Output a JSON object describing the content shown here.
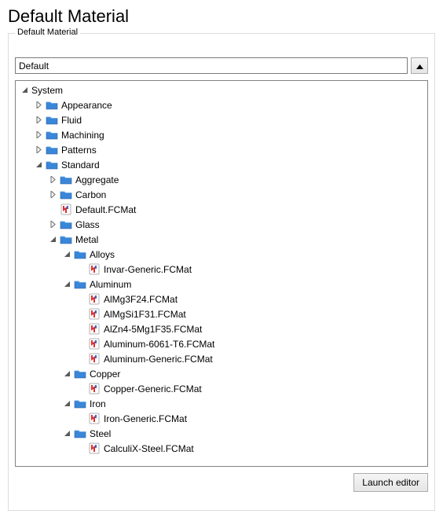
{
  "title": "Default Material",
  "group_label": "Default Material",
  "combo_value": "Default",
  "launch_editor_label": "Launch editor",
  "tree": [
    {
      "depth": 0,
      "kind": "root",
      "expand": "open",
      "label": "System"
    },
    {
      "depth": 1,
      "kind": "folder",
      "expand": "closed",
      "label": "Appearance"
    },
    {
      "depth": 1,
      "kind": "folder",
      "expand": "closed",
      "label": "Fluid"
    },
    {
      "depth": 1,
      "kind": "folder",
      "expand": "closed",
      "label": "Machining"
    },
    {
      "depth": 1,
      "kind": "folder",
      "expand": "closed",
      "label": "Patterns"
    },
    {
      "depth": 1,
      "kind": "folder",
      "expand": "open",
      "label": "Standard"
    },
    {
      "depth": 2,
      "kind": "folder",
      "expand": "closed",
      "label": "Aggregate"
    },
    {
      "depth": 2,
      "kind": "folder",
      "expand": "closed",
      "label": "Carbon"
    },
    {
      "depth": 2,
      "kind": "file",
      "expand": "none",
      "label": "Default.FCMat"
    },
    {
      "depth": 2,
      "kind": "folder",
      "expand": "closed",
      "label": "Glass"
    },
    {
      "depth": 2,
      "kind": "folder",
      "expand": "open",
      "label": "Metal"
    },
    {
      "depth": 3,
      "kind": "folder",
      "expand": "open",
      "label": "Alloys"
    },
    {
      "depth": 4,
      "kind": "file",
      "expand": "none",
      "label": "Invar-Generic.FCMat"
    },
    {
      "depth": 3,
      "kind": "folder",
      "expand": "open",
      "label": "Aluminum"
    },
    {
      "depth": 4,
      "kind": "file",
      "expand": "none",
      "label": "AlMg3F24.FCMat"
    },
    {
      "depth": 4,
      "kind": "file",
      "expand": "none",
      "label": "AlMgSi1F31.FCMat"
    },
    {
      "depth": 4,
      "kind": "file",
      "expand": "none",
      "label": "AlZn4-5Mg1F35.FCMat"
    },
    {
      "depth": 4,
      "kind": "file",
      "expand": "none",
      "label": "Aluminum-6061-T6.FCMat"
    },
    {
      "depth": 4,
      "kind": "file",
      "expand": "none",
      "label": "Aluminum-Generic.FCMat"
    },
    {
      "depth": 3,
      "kind": "folder",
      "expand": "open",
      "label": "Copper"
    },
    {
      "depth": 4,
      "kind": "file",
      "expand": "none",
      "label": "Copper-Generic.FCMat"
    },
    {
      "depth": 3,
      "kind": "folder",
      "expand": "open",
      "label": "Iron"
    },
    {
      "depth": 4,
      "kind": "file",
      "expand": "none",
      "label": "Iron-Generic.FCMat"
    },
    {
      "depth": 3,
      "kind": "folder",
      "expand": "open",
      "label": "Steel"
    },
    {
      "depth": 4,
      "kind": "file",
      "expand": "none",
      "label": "CalculiX-Steel.FCMat"
    }
  ]
}
